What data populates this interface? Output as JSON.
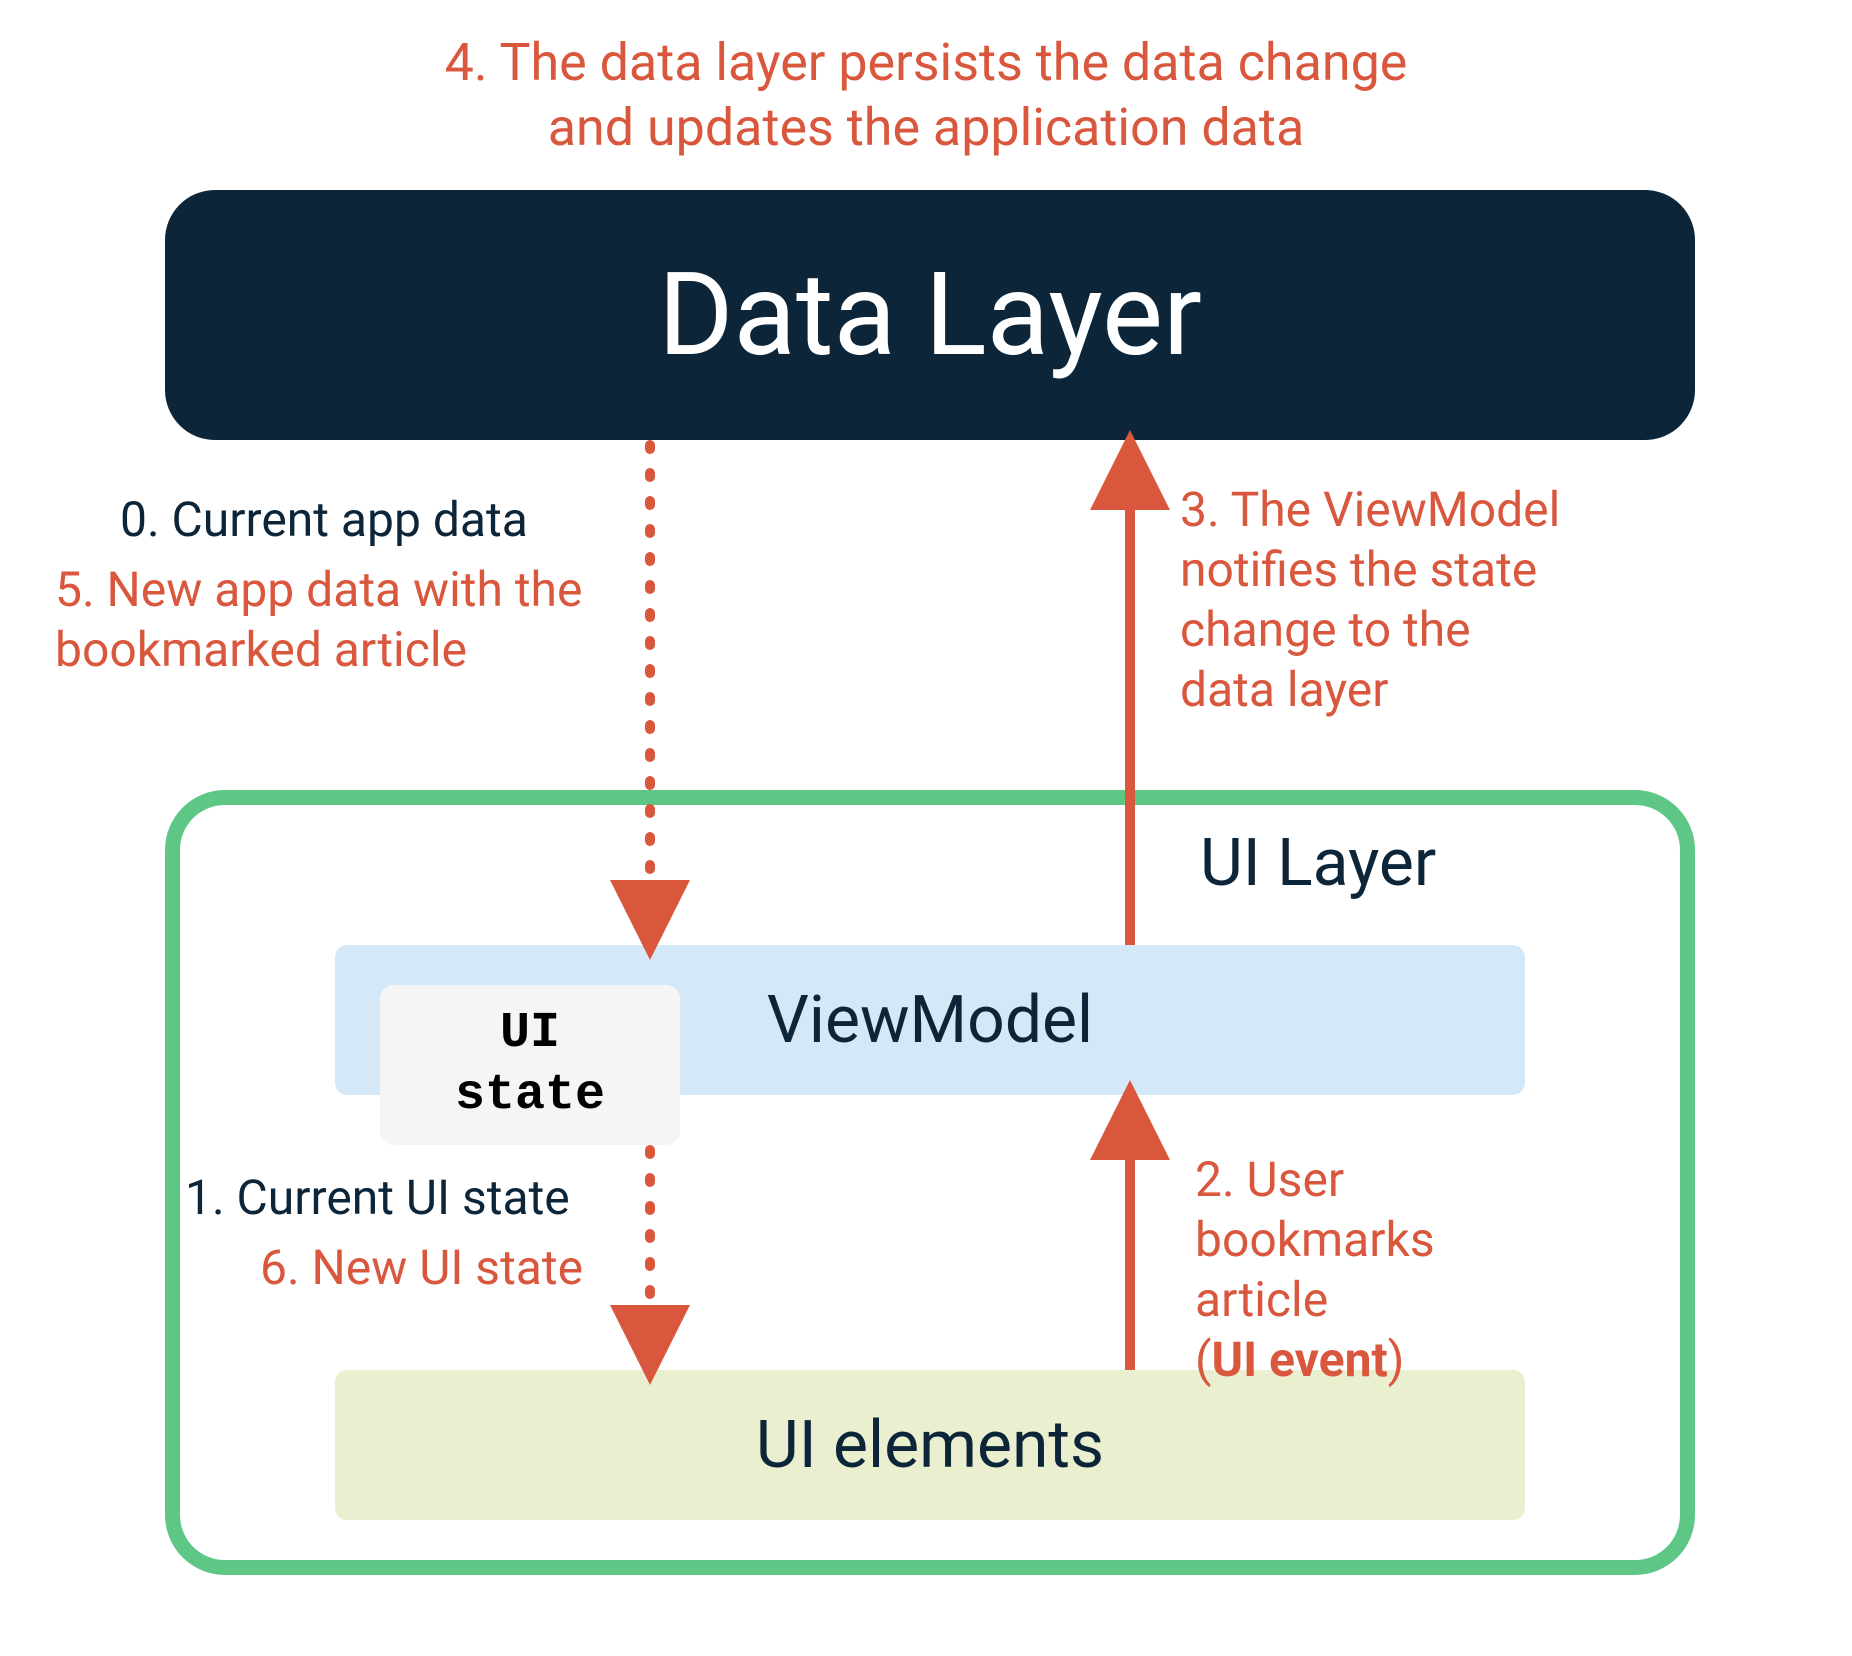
{
  "caption_top_line1": "4. The data layer persists the data change",
  "caption_top_line2": "and updates the application data",
  "boxes": {
    "data_layer": "Data Layer",
    "ui_layer_label": "UI Layer",
    "viewmodel": "ViewModel",
    "ui_state_line1": "UI",
    "ui_state_line2": "state",
    "ui_elements": "UI elements"
  },
  "labels": {
    "step0": "0. Current app data",
    "step5_line1": "5. New app data with the",
    "step5_line2": "bookmarked article",
    "step3_line1": "3. The ViewModel",
    "step3_line2": "notifies the state",
    "step3_line3": "change to the",
    "step3_line4": "data layer",
    "step1": "1. Current UI state",
    "step6": "6. New UI state",
    "step2_line1": "2. User",
    "step2_line2": "bookmarks",
    "step2_line3": "article",
    "step2_line4a": "(",
    "step2_line4b": "UI event",
    "step2_line4c": ")"
  },
  "colors": {
    "dark": "#0d2538",
    "red": "#d9573d",
    "green": "#5ec786",
    "blue_light": "#d5e8f7",
    "sand": "#eaf0cf",
    "chip_bg": "#f5f5f5"
  }
}
